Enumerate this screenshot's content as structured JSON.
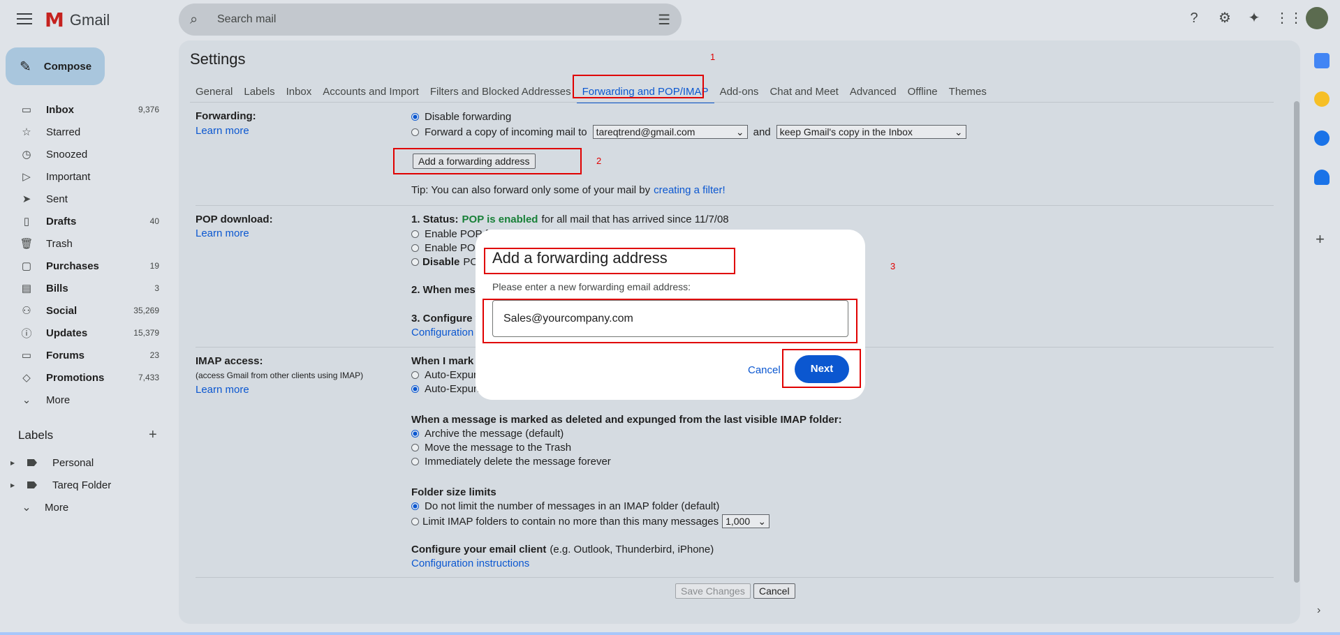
{
  "app": {
    "name": "Gmail",
    "logo_letter": "M"
  },
  "search": {
    "placeholder": "Search mail"
  },
  "compose": {
    "label": "Compose"
  },
  "nav": [
    {
      "label": "Inbox",
      "count": "9,376",
      "icon": "inbox-icon",
      "glyph": "▭",
      "bold": true
    },
    {
      "label": "Starred",
      "count": "",
      "icon": "star-icon",
      "glyph": "☆",
      "bold": false
    },
    {
      "label": "Snoozed",
      "count": "",
      "icon": "clock-icon",
      "glyph": "◷",
      "bold": false
    },
    {
      "label": "Important",
      "count": "",
      "icon": "important-icon",
      "glyph": "▷",
      "bold": false
    },
    {
      "label": "Sent",
      "count": "",
      "icon": "send-icon",
      "glyph": "➤",
      "bold": false
    },
    {
      "label": "Drafts",
      "count": "40",
      "icon": "draft-icon",
      "glyph": "▯",
      "bold": true
    },
    {
      "label": "Trash",
      "count": "",
      "icon": "trash-icon",
      "glyph": "🗑",
      "bold": false
    },
    {
      "label": "Purchases",
      "count": "19",
      "icon": "purchases-icon",
      "glyph": "▢",
      "bold": true
    },
    {
      "label": "Bills",
      "count": "3",
      "icon": "bills-icon",
      "glyph": "▤",
      "bold": true
    },
    {
      "label": "Social",
      "count": "35,269",
      "icon": "social-icon",
      "glyph": "⚇",
      "bold": true
    },
    {
      "label": "Updates",
      "count": "15,379",
      "icon": "updates-icon",
      "glyph": "ⓘ",
      "bold": true
    },
    {
      "label": "Forums",
      "count": "23",
      "icon": "forums-icon",
      "glyph": "▭",
      "bold": true
    },
    {
      "label": "Promotions",
      "count": "7,433",
      "icon": "tag-icon",
      "glyph": "◇",
      "bold": true
    },
    {
      "label": "More",
      "count": "",
      "icon": "chevron-down-icon",
      "glyph": "⌄",
      "bold": false
    }
  ],
  "labels": {
    "title": "Labels",
    "items": [
      "Personal",
      "Tareq Folder"
    ],
    "more": "More"
  },
  "settings": {
    "title": "Settings",
    "tabs": [
      "General",
      "Labels",
      "Inbox",
      "Accounts and Import",
      "Filters and Blocked Addresses",
      "Forwarding and POP/IMAP",
      "Add-ons",
      "Chat and Meet",
      "Advanced",
      "Offline",
      "Themes"
    ],
    "active_tab": "Forwarding and POP/IMAP",
    "forwarding": {
      "label": "Forwarding:",
      "learn_more": "Learn more",
      "disable": "Disable forwarding",
      "forward_copy": "Forward a copy of incoming mail to",
      "forward_email": "tareqtrend@gmail.com",
      "and": "and",
      "copy_option": "keep Gmail's copy in the Inbox",
      "add_button": "Add a forwarding address",
      "tip": "Tip: You can also forward only some of your mail by",
      "tip_link": "creating a filter!"
    },
    "pop": {
      "label": "POP download:",
      "learn_more": "Learn more",
      "status_prefix": "1. Status:",
      "status_value": "POP is enabled",
      "status_suffix": "for all mail that has arrived since 11/7/08",
      "opt1": "Enable POP f",
      "opt2": "Enable POP",
      "opt3": "Disable",
      "opt3_suffix": "PO",
      "when": "2. When mess",
      "configure": "3. Configure y",
      "config_link": "Configuration"
    },
    "imap": {
      "label": "IMAP access:",
      "sub": "(access Gmail from other clients using IMAP)",
      "learn_more": "Learn more",
      "when_mark": "When I mark a",
      "auto1": "Auto-Expun",
      "auto2": "Auto-Expun",
      "deleted_head": "When a message is marked as deleted and expunged from the last visible IMAP folder:",
      "del_opts": [
        "Archive the message (default)",
        "Move the message to the Trash",
        "Immediately delete the message forever"
      ],
      "folder_head": "Folder size limits",
      "folder_opts": [
        "Do not limit the number of messages in an IMAP folder (default)",
        "Limit IMAP folders to contain no more than this many messages"
      ],
      "folder_limit": "1,000",
      "client_head": "Configure your email client",
      "client_sub": "(e.g. Outlook, Thunderbird, iPhone)",
      "client_link": "Configuration instructions"
    },
    "save": "Save Changes",
    "cancel": "Cancel"
  },
  "modal": {
    "title": "Add a forwarding address",
    "subtitle": "Please enter a new forwarding email address:",
    "input_value": "Sales@yourcompany.com",
    "cancel": "Cancel",
    "next": "Next"
  },
  "annotations": [
    "1",
    "2",
    "3"
  ],
  "colors": {
    "accent": "#0b57d0",
    "annotation": "#e00000",
    "pop_enabled": "#188038"
  }
}
